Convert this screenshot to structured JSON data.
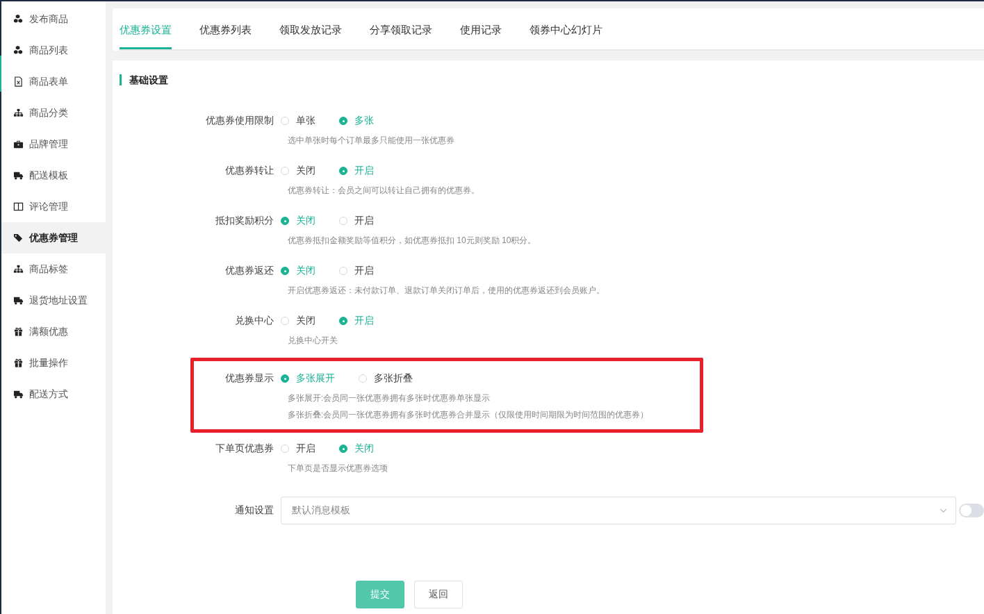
{
  "sidebar": {
    "items": [
      {
        "label": "发布商品",
        "selected": false
      },
      {
        "label": "商品列表",
        "selected": false
      },
      {
        "label": "商品表单",
        "selected": false
      },
      {
        "label": "商品分类",
        "selected": false
      },
      {
        "label": "品牌管理",
        "selected": false
      },
      {
        "label": "配送模板",
        "selected": false
      },
      {
        "label": "评论管理",
        "selected": false
      },
      {
        "label": "优惠券管理",
        "selected": true
      },
      {
        "label": "商品标签",
        "selected": false
      },
      {
        "label": "退货地址设置",
        "selected": false
      },
      {
        "label": "满额优惠",
        "selected": false
      },
      {
        "label": "批量操作",
        "selected": false
      },
      {
        "label": "配送方式",
        "selected": false
      }
    ]
  },
  "tabs": [
    {
      "label": "优惠券设置",
      "selected": true
    },
    {
      "label": "优惠券列表",
      "selected": false
    },
    {
      "label": "领取发放记录",
      "selected": false
    },
    {
      "label": "分享领取记录",
      "selected": false
    },
    {
      "label": "使用记录",
      "selected": false
    },
    {
      "label": "领券中心幻灯片",
      "selected": false
    }
  ],
  "section_title": "基础设置",
  "settings": [
    {
      "label": "优惠券使用限制",
      "options": [
        {
          "label": "单张",
          "selected": false
        },
        {
          "label": "多张",
          "selected": true
        }
      ],
      "hints": [
        "选中单张时每个订单最多只能使用一张优惠券"
      ],
      "highlighted": false
    },
    {
      "label": "优惠券转让",
      "options": [
        {
          "label": "关闭",
          "selected": false
        },
        {
          "label": "开启",
          "selected": true
        }
      ],
      "hints": [
        "优惠券转让：会员之间可以转让自己拥有的优惠券。"
      ],
      "highlighted": false
    },
    {
      "label": "抵扣奖励积分",
      "options": [
        {
          "label": "关闭",
          "selected": true
        },
        {
          "label": "开启",
          "selected": false
        }
      ],
      "hints": [
        "优惠券抵扣金额奖励等值积分，如优惠券抵扣 10元则奖励 10积分。"
      ],
      "highlighted": false
    },
    {
      "label": "优惠券返还",
      "options": [
        {
          "label": "关闭",
          "selected": true
        },
        {
          "label": "开启",
          "selected": false
        }
      ],
      "hints": [
        "开启优惠券返还：未付款订单、退款订单关闭订单后，使用的优惠券返还到会员账户。"
      ],
      "highlighted": false
    },
    {
      "label": "兑换中心",
      "options": [
        {
          "label": "关闭",
          "selected": false
        },
        {
          "label": "开启",
          "selected": true
        }
      ],
      "hints": [
        "兑换中心开关"
      ],
      "highlighted": false
    },
    {
      "label": "优惠券显示",
      "options": [
        {
          "label": "多张展开",
          "selected": true
        },
        {
          "label": "多张折叠",
          "selected": false
        }
      ],
      "hints": [
        "多张展开:会员同一张优惠券拥有多张时优惠券单张显示",
        "多张折叠:会员同一张优惠券拥有多张时优惠券合并显示（仅限使用时间期限为时间范围的优惠券）"
      ],
      "highlighted": true
    },
    {
      "label": "下单页优惠券",
      "options": [
        {
          "label": "开启",
          "selected": false
        },
        {
          "label": "关闭",
          "selected": true
        }
      ],
      "hints": [
        "下单页是否显示优惠券选项"
      ],
      "highlighted": false
    }
  ],
  "notification": {
    "label": "通知设置",
    "placeholder": "默认消息模板",
    "toggle_on": false
  },
  "buttons": [
    {
      "label": "提交",
      "kind": "primary"
    },
    {
      "label": "返回",
      "kind": "default"
    }
  ]
}
